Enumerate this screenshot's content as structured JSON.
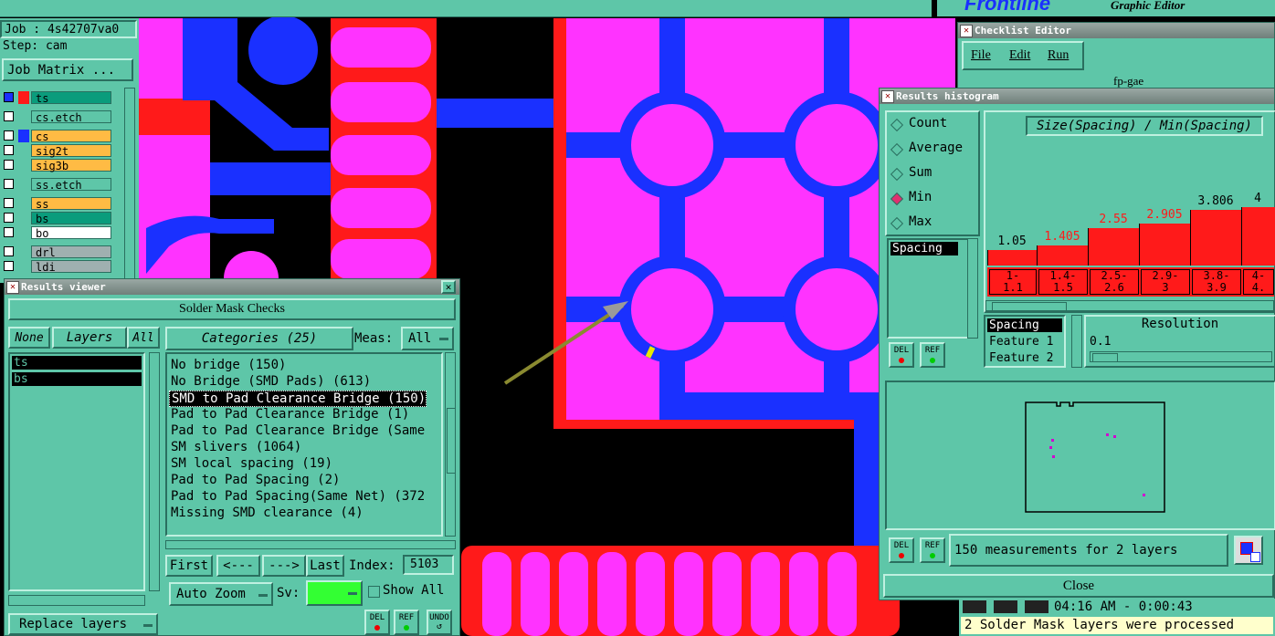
{
  "job_panel": {
    "job": "Job : 4s42707va0",
    "step": "Step: cam",
    "job_matrix_btn": "Job Matrix ...",
    "layers": [
      {
        "name": "ts",
        "color": "#0a9c7c",
        "swatch": "#ff1a1a"
      },
      {
        "name": "cs.etch",
        "color": "#5ec6a8",
        "swatch": ""
      },
      {
        "name": "cs",
        "color": "#ffbb44",
        "swatch": "#1a30ff"
      },
      {
        "name": "sig2t",
        "color": "#ffbb44",
        "swatch": ""
      },
      {
        "name": "sig3b",
        "color": "#ffbb44",
        "swatch": ""
      },
      {
        "name": "ss.etch",
        "color": "#5ec6a8",
        "swatch": ""
      },
      {
        "name": "ss",
        "color": "#ffbb44",
        "swatch": ""
      },
      {
        "name": "bs",
        "color": "#0a9c7c",
        "swatch": ""
      },
      {
        "name": "bo",
        "color": "#ffffff",
        "swatch": ""
      },
      {
        "name": "drl",
        "color": "#9fb0b0",
        "swatch": ""
      },
      {
        "name": "ldi",
        "color": "#9fb0b0",
        "swatch": ""
      }
    ]
  },
  "header": {
    "brand": "Frontline",
    "subtitle": "Graphic Editor"
  },
  "checklist_editor": {
    "title": "Checklist Editor",
    "menu": [
      "File",
      "Edit",
      "Run"
    ],
    "field": "fp-gae"
  },
  "results_viewer": {
    "title": "Results viewer",
    "heading": "Solder Mask Checks",
    "none_btn": "None",
    "layers_label": "Layers",
    "all_btn": "All",
    "layer_list": [
      "ts",
      "bs"
    ],
    "categories_label": "Categories (25)",
    "meas_label": "Meas:",
    "meas_value": "All",
    "categories": [
      "No bridge (150)",
      "No Bridge (SMD Pads) (613)",
      "SMD to Pad Clearance Bridge (150)",
      "Pad to Pad Clearance Bridge (1)",
      "Pad to Pad Clearance Bridge (Same",
      "SM slivers (1064)",
      "SM local spacing (19)",
      "Pad to Pad Spacing (2)",
      "Pad to Pad Spacing(Same Net) (372",
      "Missing SMD clearance (4)"
    ],
    "selected_category_index": 2,
    "first_btn": "First",
    "prev_btn": "<---",
    "next_btn": "--->",
    "last_btn": "Last",
    "index_label": "Index:",
    "index_value": "5103",
    "auto_zoom": "Auto Zoom",
    "sv_label": "Sv:",
    "show_all": "Show All",
    "replace_layers": "Replace layers",
    "del": "DEL",
    "ref": "REF",
    "undo": "UNDO"
  },
  "histogram": {
    "title": "Results histogram",
    "modes": [
      "Count",
      "Average",
      "Sum",
      "Min",
      "Max"
    ],
    "selected_mode": "Min",
    "list_selected": "Spacing",
    "chart_title": "Size(Spacing) / Min(Spacing)",
    "chart_data": {
      "type": "bar",
      "categories": [
        "1-1.1",
        "1.4-1.5",
        "2.5-2.6",
        "2.9-3",
        "3.8-3.9",
        "4-4."
      ],
      "values": [
        1.05,
        1.405,
        2.55,
        2.905,
        3.806,
        4
      ],
      "value_labels": [
        "1.05",
        "1.405",
        "2.55",
        "2.905",
        "3.806",
        "4"
      ],
      "label_colors": [
        "#000000",
        "#ff1a1a",
        "#ff1a1a",
        "#ff1a1a",
        "#000000",
        "#000000"
      ],
      "bin_labels": [
        [
          "1-",
          "1.1"
        ],
        [
          "1.4-",
          "1.5"
        ],
        [
          "2.5-",
          "2.6"
        ],
        [
          "2.9-",
          "3"
        ],
        [
          "3.8-",
          "3.9"
        ],
        [
          "4-",
          "4."
        ]
      ],
      "bar_color": "#ff1a1a"
    },
    "attr_list": [
      "Spacing",
      "Feature 1",
      "Feature 2"
    ],
    "resolution_label": "Resolution",
    "resolution_value": "0.1",
    "status": "150 measurements for 2 layers",
    "close": "Close",
    "del": "DEL",
    "ref": "REF"
  },
  "bottom_status": {
    "time": "04:16 AM - 0:00:43",
    "message": "2 Solder Mask layers were processed"
  },
  "colors": {
    "panel": "#5ec6a8",
    "copper_blue": "#1a30ff",
    "mask_magenta": "#ff33ff",
    "mask_red": "#ff1a1a"
  }
}
